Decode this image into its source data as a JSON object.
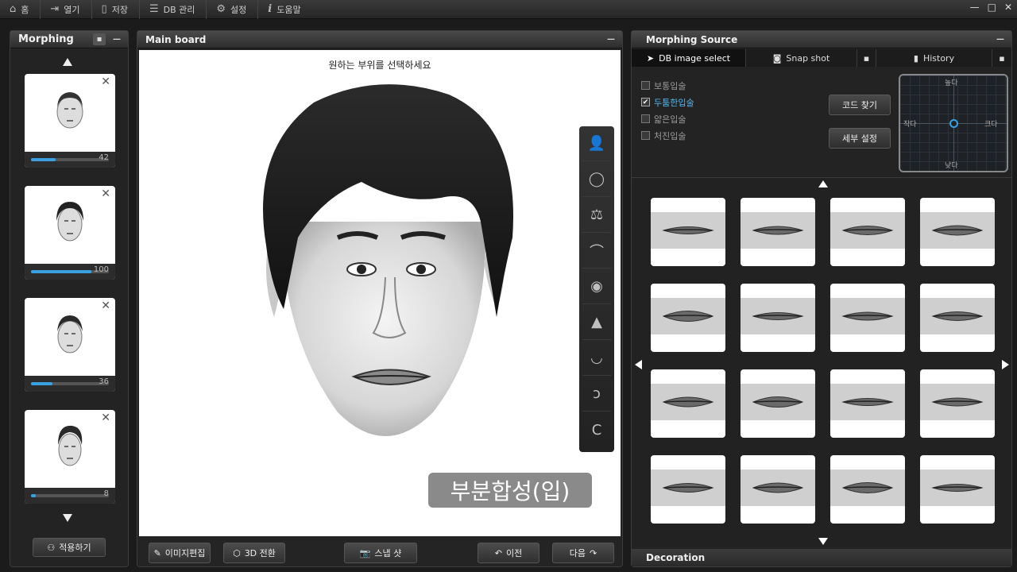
{
  "topbar": {
    "items": [
      {
        "icon": "home-icon",
        "label": "홈"
      },
      {
        "icon": "open-icon",
        "label": "열기"
      },
      {
        "icon": "save-icon",
        "label": "저장"
      },
      {
        "icon": "db-icon",
        "label": "DB 관리"
      },
      {
        "icon": "gear-icon",
        "label": "설정"
      },
      {
        "icon": "info-icon",
        "label": "도움말"
      }
    ],
    "window_controls": [
      "—",
      "□",
      "✕"
    ]
  },
  "morphing": {
    "title": "Morphing",
    "items": [
      {
        "value": "42",
        "level": 0.32
      },
      {
        "value": "100",
        "level": 0.78
      },
      {
        "value": "36",
        "level": 0.28
      },
      {
        "value": "8",
        "level": 0.06
      }
    ],
    "apply_label": "적용하기"
  },
  "main": {
    "title": "Main board",
    "prompt": "원하는 부위를 선택하세요",
    "caption": "부분합성(입)",
    "tools": [
      "person-icon",
      "face-outline-icon",
      "hair-icon",
      "eyebrow-icon",
      "eye-icon",
      "nose-icon",
      "mouth-icon",
      "ear-icon",
      "chin-icon"
    ],
    "buttons": {
      "edit": "이미지편집",
      "three_d": "3D 전환",
      "snapshot": "스냅 샷",
      "prev": "이전",
      "next": "다음"
    }
  },
  "source": {
    "title": "Morphing Source",
    "tabs": [
      "DB image select",
      "Snap shot",
      "History"
    ],
    "options": [
      {
        "label": "보통입술",
        "checked": false
      },
      {
        "label": "두툼한입술",
        "checked": true
      },
      {
        "label": "얇은입술",
        "checked": false
      },
      {
        "label": "처진입술",
        "checked": false
      }
    ],
    "code_button": "코드 찾기",
    "detail_button": "세부 설정",
    "pad": {
      "top": "높다",
      "bottom": "낮다",
      "left": "작다",
      "right": "크다"
    },
    "decoration": "Decoration"
  },
  "colors": {
    "accent": "#3aa0e0",
    "selected_text": "#57b6f0"
  }
}
